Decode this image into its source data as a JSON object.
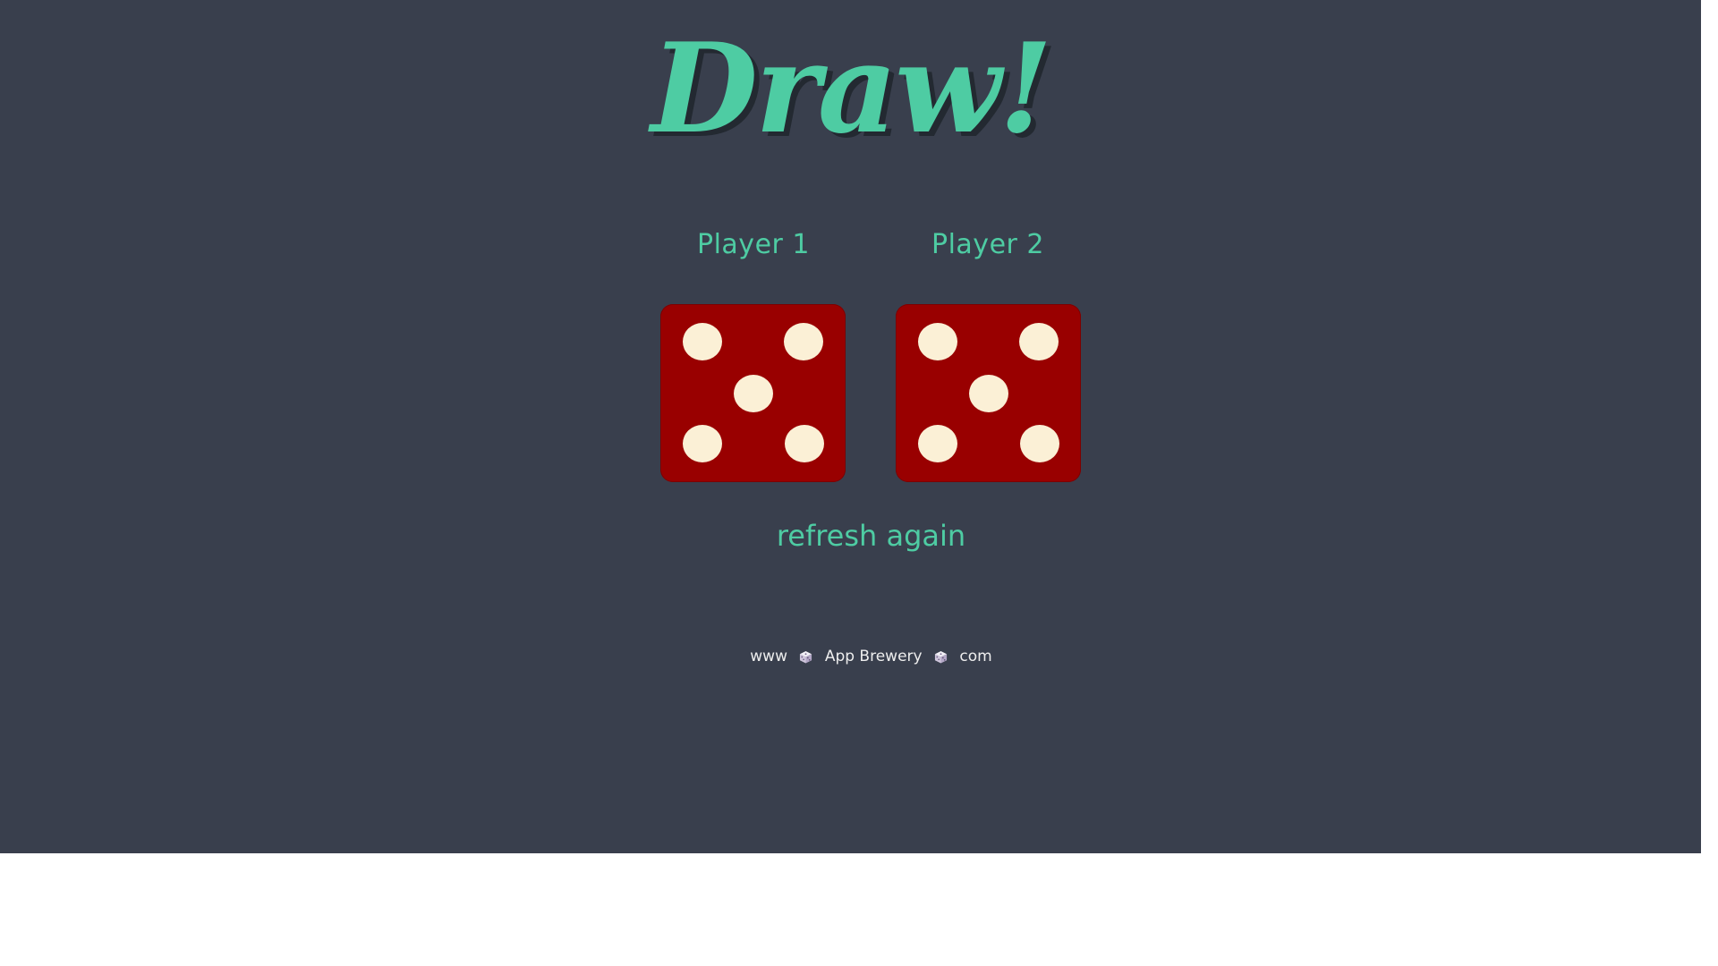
{
  "header": {
    "title": "Draw!"
  },
  "players": [
    {
      "label": "Player 1",
      "die_value": 5
    },
    {
      "label": "Player 2",
      "die_value": 5
    }
  ],
  "refresh": {
    "label": "refresh again"
  },
  "footer": {
    "prefix": "www",
    "brand": "App Brewery",
    "suffix": "com",
    "separator_icon": "dice-icon"
  },
  "colors": {
    "background": "#393F4D",
    "accent": "#4ECCA3",
    "title_shadow": "#232931",
    "die_face": "#990000",
    "die_pip": "#FBF0D6",
    "footer_text": "#EEEEEE"
  }
}
